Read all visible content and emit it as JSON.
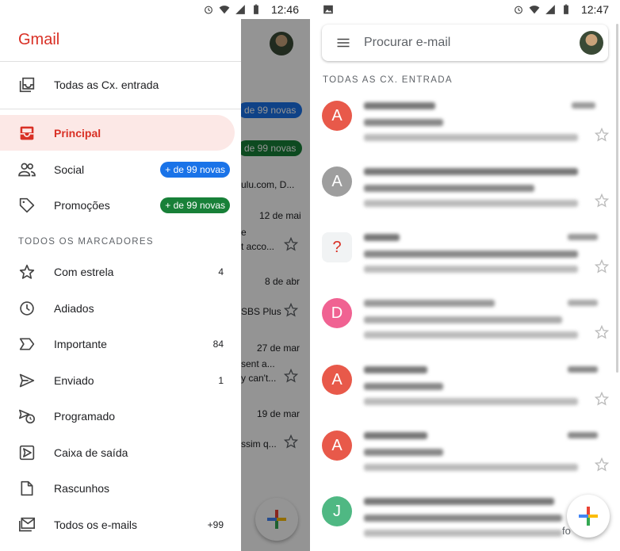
{
  "left_status": {
    "time": "12:46"
  },
  "right_status": {
    "time": "12:47"
  },
  "drawer": {
    "logo": "Gmail",
    "all_inboxes": "Todas as Cx. entrada",
    "categories": [
      {
        "label": "Principal",
        "badge": ""
      },
      {
        "label": "Social",
        "badge": "+ de 99 novas",
        "badge_color": "#1a73e8"
      },
      {
        "label": "Promoções",
        "badge": "+ de 99 novas",
        "badge_color": "#188038"
      }
    ],
    "labels_title": "TODOS OS MARCADORES",
    "labels": [
      {
        "label": "Com estrela",
        "count": "4",
        "icon": "star-icon"
      },
      {
        "label": "Adiados",
        "count": "",
        "icon": "clock-icon"
      },
      {
        "label": "Importante",
        "count": "84",
        "icon": "important-icon"
      },
      {
        "label": "Enviado",
        "count": "1",
        "icon": "send-icon"
      },
      {
        "label": "Programado",
        "count": "",
        "icon": "scheduled-icon"
      },
      {
        "label": "Caixa de saída",
        "count": "",
        "icon": "outbox-icon"
      },
      {
        "label": "Rascunhos",
        "count": "",
        "icon": "draft-icon"
      },
      {
        "label": "Todos os e-mails",
        "count": "+99",
        "icon": "all-mail-icon"
      }
    ]
  },
  "background": {
    "badges": [
      "de 99 novas",
      "de 99 novas"
    ],
    "snippets": [
      "ulu.com, D...",
      "12 de mai",
      "e",
      "t acco...",
      "8 de abr",
      "SBS Plus",
      "27 de mar",
      "sent a...",
      "y can't...",
      "19 de mar",
      "ssim q..."
    ]
  },
  "inbox": {
    "search_placeholder": "Procurar e-mail",
    "title": "TODAS AS CX. ENTRADA",
    "rows": [
      {
        "letter": "A",
        "color": "#e8594a"
      },
      {
        "letter": "A",
        "color": "#9e9e9e"
      },
      {
        "letter": "?",
        "color": "#f1f3f4",
        "fg": "#d93025"
      },
      {
        "letter": "D",
        "color": "#f06292"
      },
      {
        "letter": "A",
        "color": "#e8594a"
      },
      {
        "letter": "A",
        "color": "#e8594a"
      },
      {
        "letter": "J",
        "color": "#4fb883"
      }
    ],
    "last_row_snippet": "fo"
  },
  "colors": {
    "accent_red": "#d93025",
    "active_bg": "#fce8e6"
  }
}
